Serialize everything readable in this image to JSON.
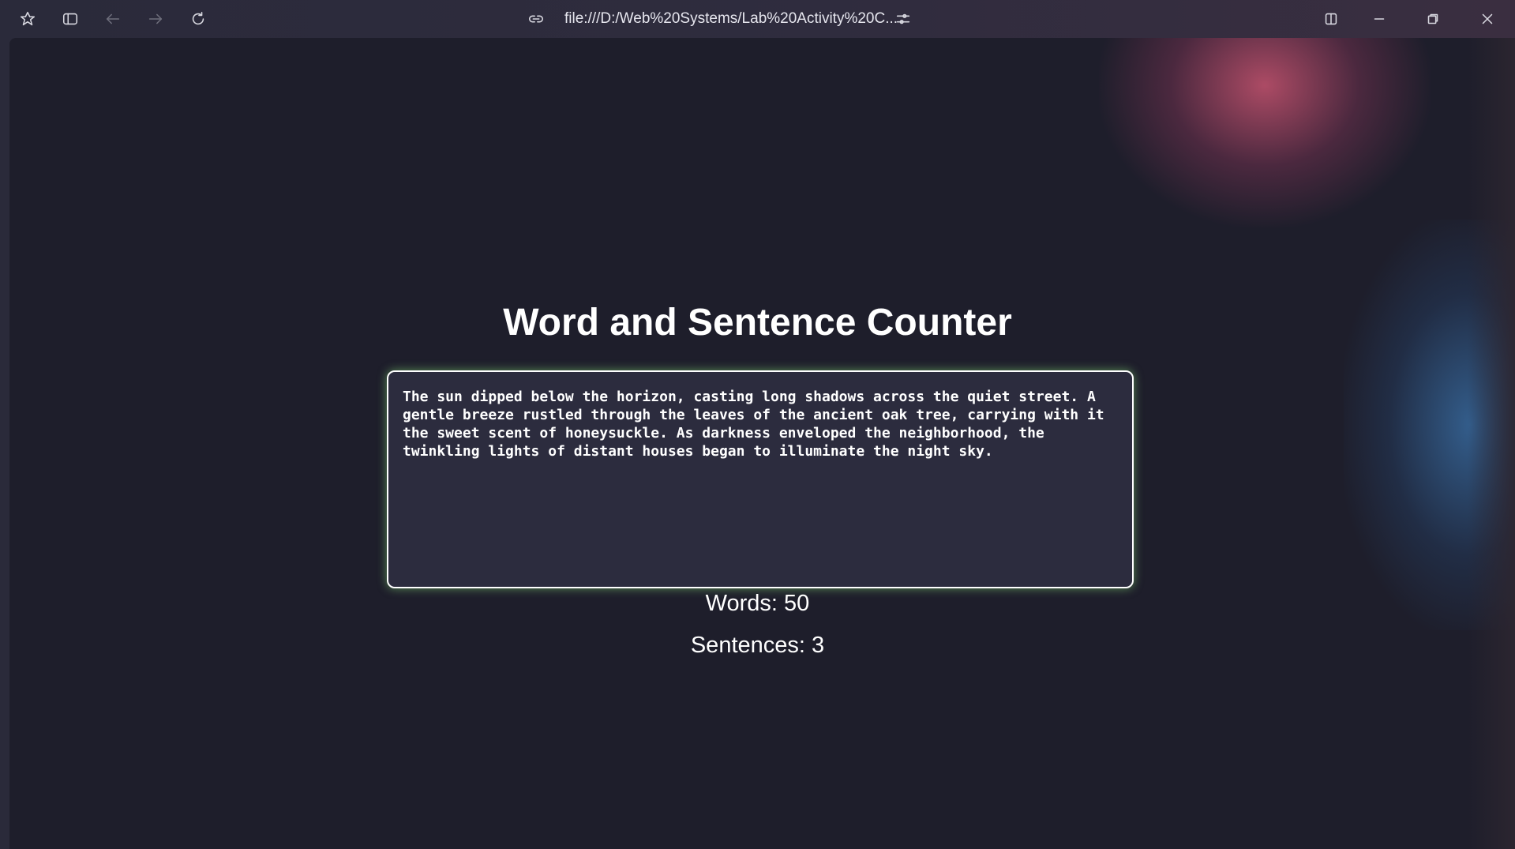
{
  "browser": {
    "url": "file:///D:/Web%20Systems/Lab%20Activity%20C...",
    "icons": [
      "app-logo-icon",
      "sidebar-icon",
      "back-icon",
      "forward-icon",
      "reload-icon",
      "link-icon",
      "site-settings-icon",
      "split-view-icon",
      "minimize-icon",
      "restore-icon",
      "close-icon"
    ]
  },
  "page": {
    "title": "Word and Sentence Counter",
    "text": "The sun dipped below the horizon, casting long shadows across the quiet street. A gentle breeze rustled through the leaves of the ancient oak tree, carrying with it the sweet scent of honeysuckle. As darkness enveloped the neighborhood, the twinkling lights of distant houses began to illuminate the night sky.",
    "words_label": "Words: 50",
    "sentences_label": "Sentences: 3"
  },
  "colors": {
    "background": "#1e1e2b",
    "textarea_bg": "#2c2c3e",
    "textarea_glow": "#8ce678",
    "text": "#ffffff"
  }
}
